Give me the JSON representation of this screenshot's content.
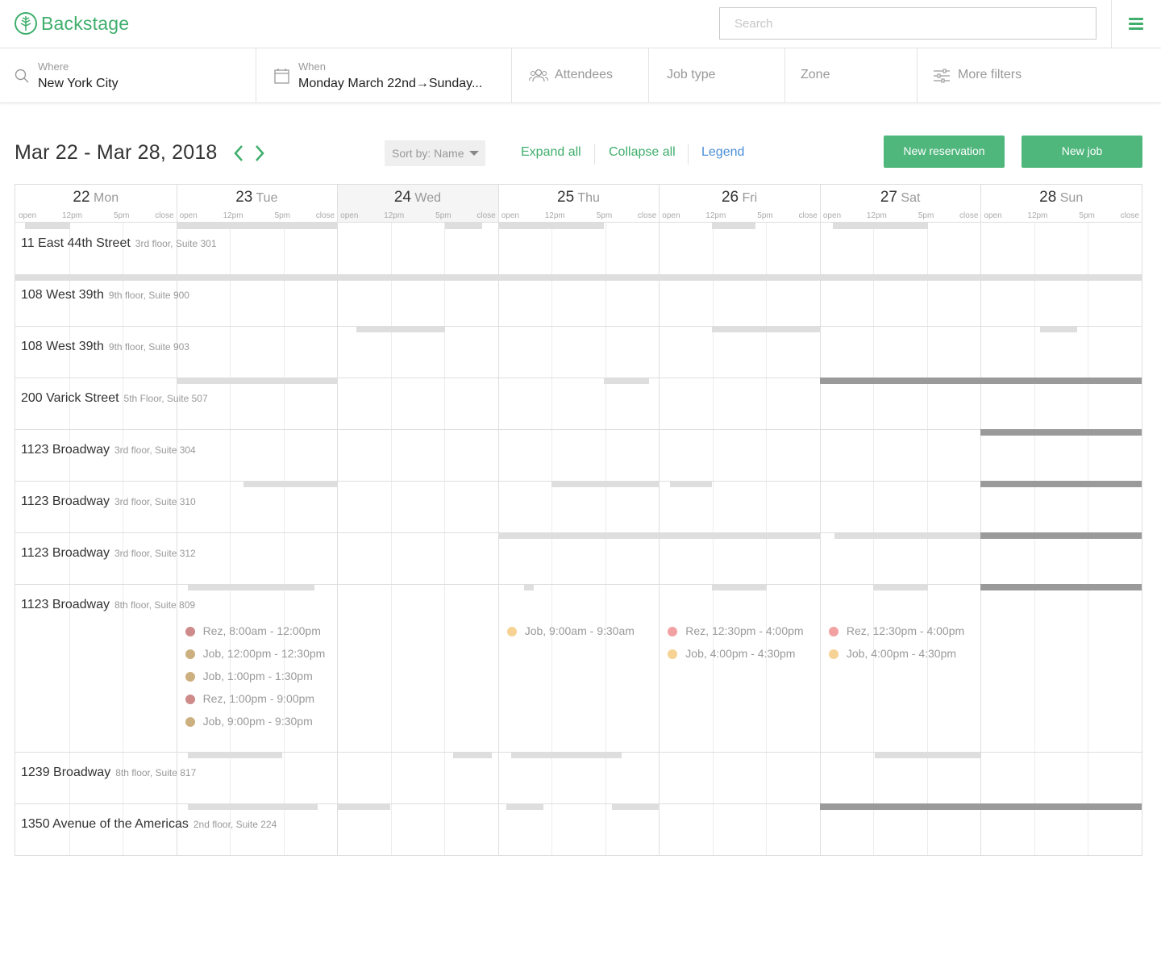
{
  "app": {
    "name": "Backstage"
  },
  "search": {
    "placeholder": "Search"
  },
  "filters": {
    "where": {
      "label": "Where",
      "value": "New York City"
    },
    "when": {
      "label": "When",
      "value": "Monday March 22nd→Sunday..."
    },
    "attendees": {
      "label": "Attendees"
    },
    "job_type": {
      "label": "Job type"
    },
    "zone": {
      "label": "Zone"
    },
    "more": {
      "label": "More filters"
    }
  },
  "toolbar": {
    "range": "Mar 22 - Mar 28, 2018",
    "sort_label": "Sort by: Name",
    "expand_all": "Expand all",
    "collapse_all": "Collapse all",
    "legend": "Legend",
    "new_reservation": "New reservation",
    "new_job": "New job"
  },
  "colors": {
    "brand": "#3fae6c",
    "button": "#4fb67c",
    "legend_link": "#4a8fd9",
    "rez_past": "#cf8a8a",
    "job_past": "#cdb07f",
    "rez": "#f2a1a3",
    "job": "#f6d394"
  },
  "calendar": {
    "tick_labels": [
      "open",
      "12pm",
      "5pm",
      "close"
    ],
    "days": [
      {
        "num": "22",
        "name": "Mon"
      },
      {
        "num": "23",
        "name": "Tue"
      },
      {
        "num": "24",
        "name": "Wed",
        "today": true
      },
      {
        "num": "25",
        "name": "Thu"
      },
      {
        "num": "26",
        "name": "Fri"
      },
      {
        "num": "27",
        "name": "Sat"
      },
      {
        "num": "28",
        "name": "Sun"
      }
    ],
    "rows": [
      {
        "name": "11 East 44th Street",
        "sub": "3rd floor, Suite 301"
      },
      {
        "name": "108 West 39th",
        "sub": "9th floor, Suite 900"
      },
      {
        "name": "108 West 39th",
        "sub": "9th floor, Suite 903"
      },
      {
        "name": "200 Varick Street",
        "sub": "5th Floor, Suite 507"
      },
      {
        "name": "1123 Broadway",
        "sub": "3rd floor, Suite 304"
      },
      {
        "name": "1123 Broadway",
        "sub": "3rd floor, Suite 310"
      },
      {
        "name": "1123 Broadway",
        "sub": "3rd floor, Suite 312"
      },
      {
        "name": "1123 Broadway",
        "sub": "8th floor, Suite 809",
        "expanded": true,
        "events": [
          {
            "day": 1,
            "type": "rez",
            "tone": "past",
            "text": "Rez, 8:00am - 12:00pm"
          },
          {
            "day": 1,
            "type": "job",
            "tone": "past",
            "text": "Job, 12:00pm - 12:30pm"
          },
          {
            "day": 1,
            "type": "job",
            "tone": "past",
            "text": "Job, 1:00pm - 1:30pm"
          },
          {
            "day": 1,
            "type": "rez",
            "tone": "past",
            "text": "Rez, 1:00pm - 9:00pm"
          },
          {
            "day": 1,
            "type": "job",
            "tone": "past",
            "text": "Job, 9:00pm - 9:30pm"
          },
          {
            "day": 3,
            "type": "job",
            "tone": "future",
            "text": "Job, 9:00am - 9:30am"
          },
          {
            "day": 4,
            "type": "rez",
            "tone": "future",
            "text": "Rez, 12:30pm - 4:00pm"
          },
          {
            "day": 4,
            "type": "job",
            "tone": "future",
            "text": "Job, 4:00pm - 4:30pm"
          },
          {
            "day": 5,
            "type": "rez",
            "tone": "future",
            "text": "Rez, 12:30pm - 4:00pm"
          },
          {
            "day": 5,
            "type": "job",
            "tone": "future",
            "text": "Job, 4:00pm - 4:30pm"
          }
        ]
      },
      {
        "name": "1239 Broadway",
        "sub": "8th floor, Suite 817"
      },
      {
        "name": "1350 Avenue of the Americas",
        "sub": "2nd floor, Suite 224"
      }
    ],
    "bookings": [
      {
        "row": 0,
        "start": 0.06,
        "end": 0.34
      },
      {
        "row": 0,
        "start": 1.0,
        "end": 2.0
      },
      {
        "row": 0,
        "start": 2.67,
        "end": 2.9
      },
      {
        "row": 0,
        "start": 3.0,
        "end": 3.66
      },
      {
        "row": 0,
        "start": 4.33,
        "end": 4.6
      },
      {
        "row": 0,
        "start": 5.08,
        "end": 5.67
      },
      {
        "row": 1,
        "start": 0.0,
        "end": 7.0
      },
      {
        "row": 2,
        "start": 2.12,
        "end": 2.67
      },
      {
        "row": 2,
        "start": 4.33,
        "end": 5.0
      },
      {
        "row": 2,
        "start": 6.37,
        "end": 6.6
      },
      {
        "row": 3,
        "start": 1.0,
        "end": 2.0
      },
      {
        "row": 3,
        "start": 3.66,
        "end": 3.94
      },
      {
        "row": 3,
        "start": 5.0,
        "end": 7.0,
        "status": "dark"
      },
      {
        "row": 4,
        "start": 6.0,
        "end": 7.0,
        "status": "dark"
      },
      {
        "row": 5,
        "start": 1.42,
        "end": 2.0
      },
      {
        "row": 5,
        "start": 3.33,
        "end": 4.0
      },
      {
        "row": 5,
        "start": 4.07,
        "end": 4.33
      },
      {
        "row": 5,
        "start": 6.0,
        "end": 7.0,
        "status": "dark"
      },
      {
        "row": 6,
        "start": 3.0,
        "end": 5.0
      },
      {
        "row": 6,
        "start": 5.09,
        "end": 6.0
      },
      {
        "row": 6,
        "start": 6.0,
        "end": 7.0,
        "status": "dark"
      },
      {
        "row": 7,
        "start": 1.07,
        "end": 1.86
      },
      {
        "row": 7,
        "start": 3.16,
        "end": 3.22
      },
      {
        "row": 7,
        "start": 4.33,
        "end": 4.67
      },
      {
        "row": 7,
        "start": 5.33,
        "end": 5.67
      },
      {
        "row": 7,
        "start": 6.0,
        "end": 7.0,
        "status": "dark"
      },
      {
        "row": 8,
        "start": 1.07,
        "end": 1.66
      },
      {
        "row": 8,
        "start": 2.72,
        "end": 2.96
      },
      {
        "row": 8,
        "start": 3.08,
        "end": 3.77
      },
      {
        "row": 8,
        "start": 5.34,
        "end": 6.0
      },
      {
        "row": 9,
        "start": 1.07,
        "end": 1.88
      },
      {
        "row": 9,
        "start": 2.0,
        "end": 2.33
      },
      {
        "row": 9,
        "start": 3.05,
        "end": 3.28
      },
      {
        "row": 9,
        "start": 3.71,
        "end": 4.0
      },
      {
        "row": 9,
        "start": 5.0,
        "end": 7.0,
        "status": "dark"
      }
    ]
  }
}
